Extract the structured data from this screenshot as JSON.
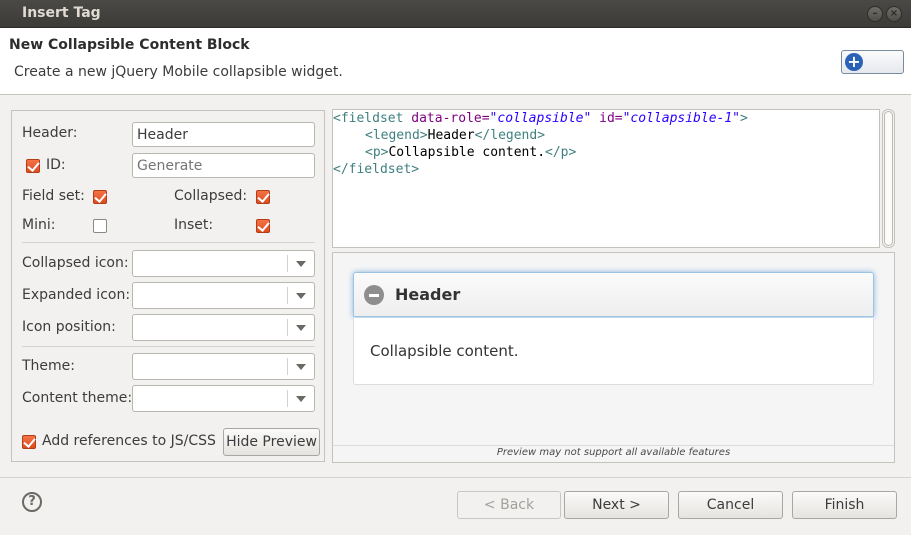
{
  "window": {
    "title": "Insert Tag"
  },
  "header": {
    "title": "New Collapsible Content Block",
    "description": "Create a new jQuery Mobile collapsible widget."
  },
  "form": {
    "header_label": "Header:",
    "header_value": "Header",
    "id_label": "ID:",
    "id_checked": true,
    "id_placeholder": "Generate",
    "fieldset_label": "Field set:",
    "fieldset_checked": true,
    "collapsed_label": "Collapsed:",
    "collapsed_checked": true,
    "mini_label": "Mini:",
    "mini_checked": false,
    "inset_label": "Inset:",
    "inset_checked": true,
    "collapsed_icon_label": "Collapsed icon:",
    "expanded_icon_label": "Expanded icon:",
    "icon_position_label": "Icon position:",
    "theme_label": "Theme:",
    "content_theme_label": "Content theme:",
    "add_refs_label": "Add references to JS/CSS",
    "add_refs_checked": true,
    "hide_preview_label": "Hide Preview"
  },
  "code": {
    "l1_tag_open": "<fieldset",
    "l1_attr1": " data-role=",
    "l1_val1": "\"collapsible\"",
    "l1_attr2": " id=",
    "l1_val2": "\"collapsible-1\"",
    "l1_tag_close": ">",
    "l2_tag_open": "<legend>",
    "l2_text": "Header",
    "l2_tag_close": "</legend>",
    "l3_tag_open": "<p>",
    "l3_text": "Collapsible content.",
    "l3_tag_close": "</p>",
    "l4_tag": "</fieldset>"
  },
  "preview": {
    "header_text": "Header",
    "content_text": "Collapsible content.",
    "note": "Preview may not support all available features"
  },
  "buttons": {
    "back": "< Back",
    "next": "Next >",
    "cancel": "Cancel",
    "finish": "Finish",
    "help": "?"
  },
  "icons": {
    "minimize": "minimize-icon",
    "close": "close-icon",
    "wizard": "plus-icon",
    "collapse": "minus-icon",
    "help": "help-icon"
  },
  "colors": {
    "accent_check": "#df4b1c",
    "titlebar": "#3c3b37",
    "preview_glow": "#8ab6e2"
  }
}
